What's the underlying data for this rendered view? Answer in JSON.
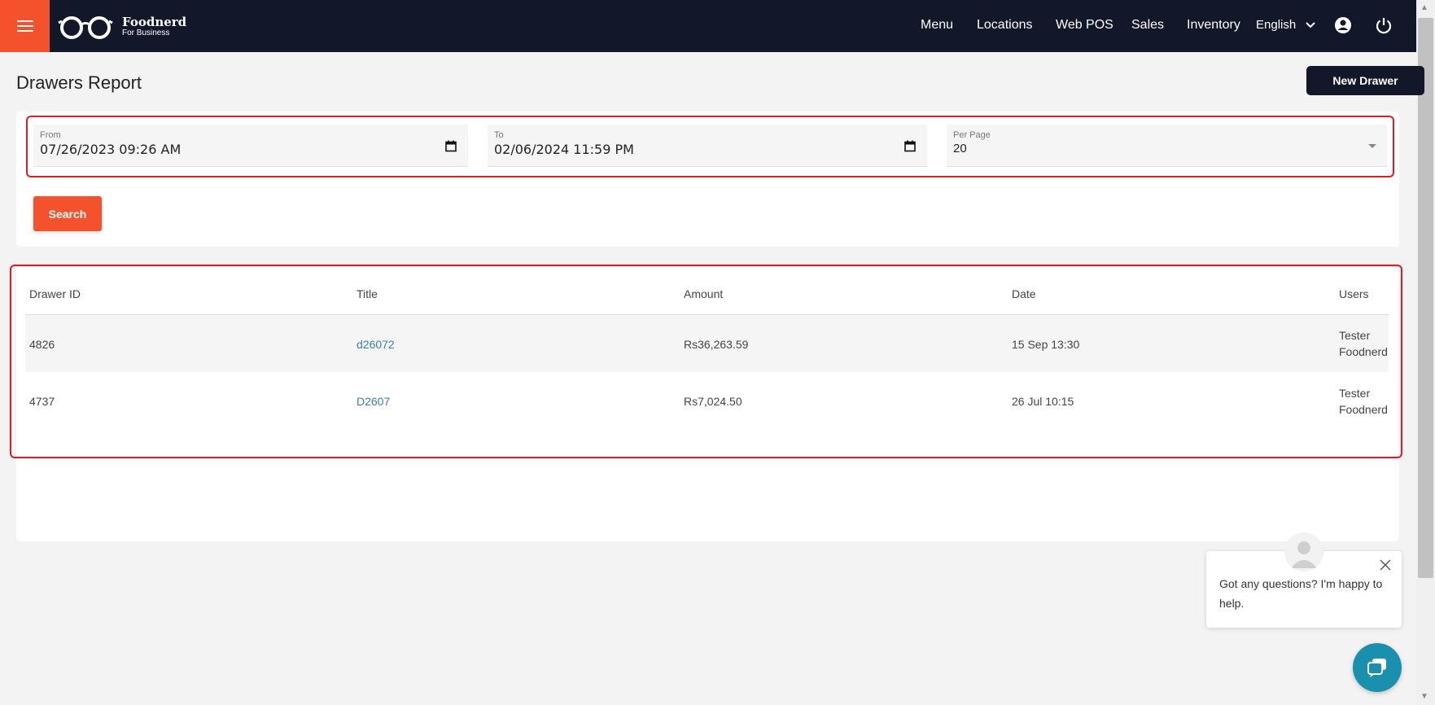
{
  "app": {
    "logo_name": "Foodnerd",
    "logo_sub": "For Business"
  },
  "nav": {
    "items": [
      "Menu",
      "Locations",
      "Web POS",
      "Sales",
      "Inventory"
    ],
    "language": "English"
  },
  "page": {
    "title": "Drawers Report",
    "new_drawer_label": "New Drawer"
  },
  "filters": {
    "from": {
      "label": "From",
      "value": "07/26/2023 09:26 AM"
    },
    "to": {
      "label": "To",
      "value": "02/06/2024 11:59 PM"
    },
    "per_page": {
      "label": "Per Page",
      "value": "20"
    },
    "search_label": "Search"
  },
  "table": {
    "headers": [
      "Drawer ID",
      "Title",
      "Amount",
      "Date",
      "Users"
    ],
    "rows": [
      {
        "id": "4826",
        "title": "d26072",
        "amount": "Rs36,263.59",
        "date": "15 Sep 13:30",
        "users": [
          "Tester",
          "Foodnerd"
        ]
      },
      {
        "id": "4737",
        "title": "D2607",
        "amount": "Rs7,024.50",
        "date": "26 Jul 10:15",
        "users": [
          "Tester",
          "Foodnerd"
        ]
      }
    ]
  },
  "chat": {
    "message": "Got any questions? I'm happy to help."
  },
  "colors": {
    "brand": "#f4512c",
    "nav_bg": "#12172a",
    "highlight": "#e11b22",
    "link": "#3a7fa6",
    "chat": "#1a8fae"
  }
}
